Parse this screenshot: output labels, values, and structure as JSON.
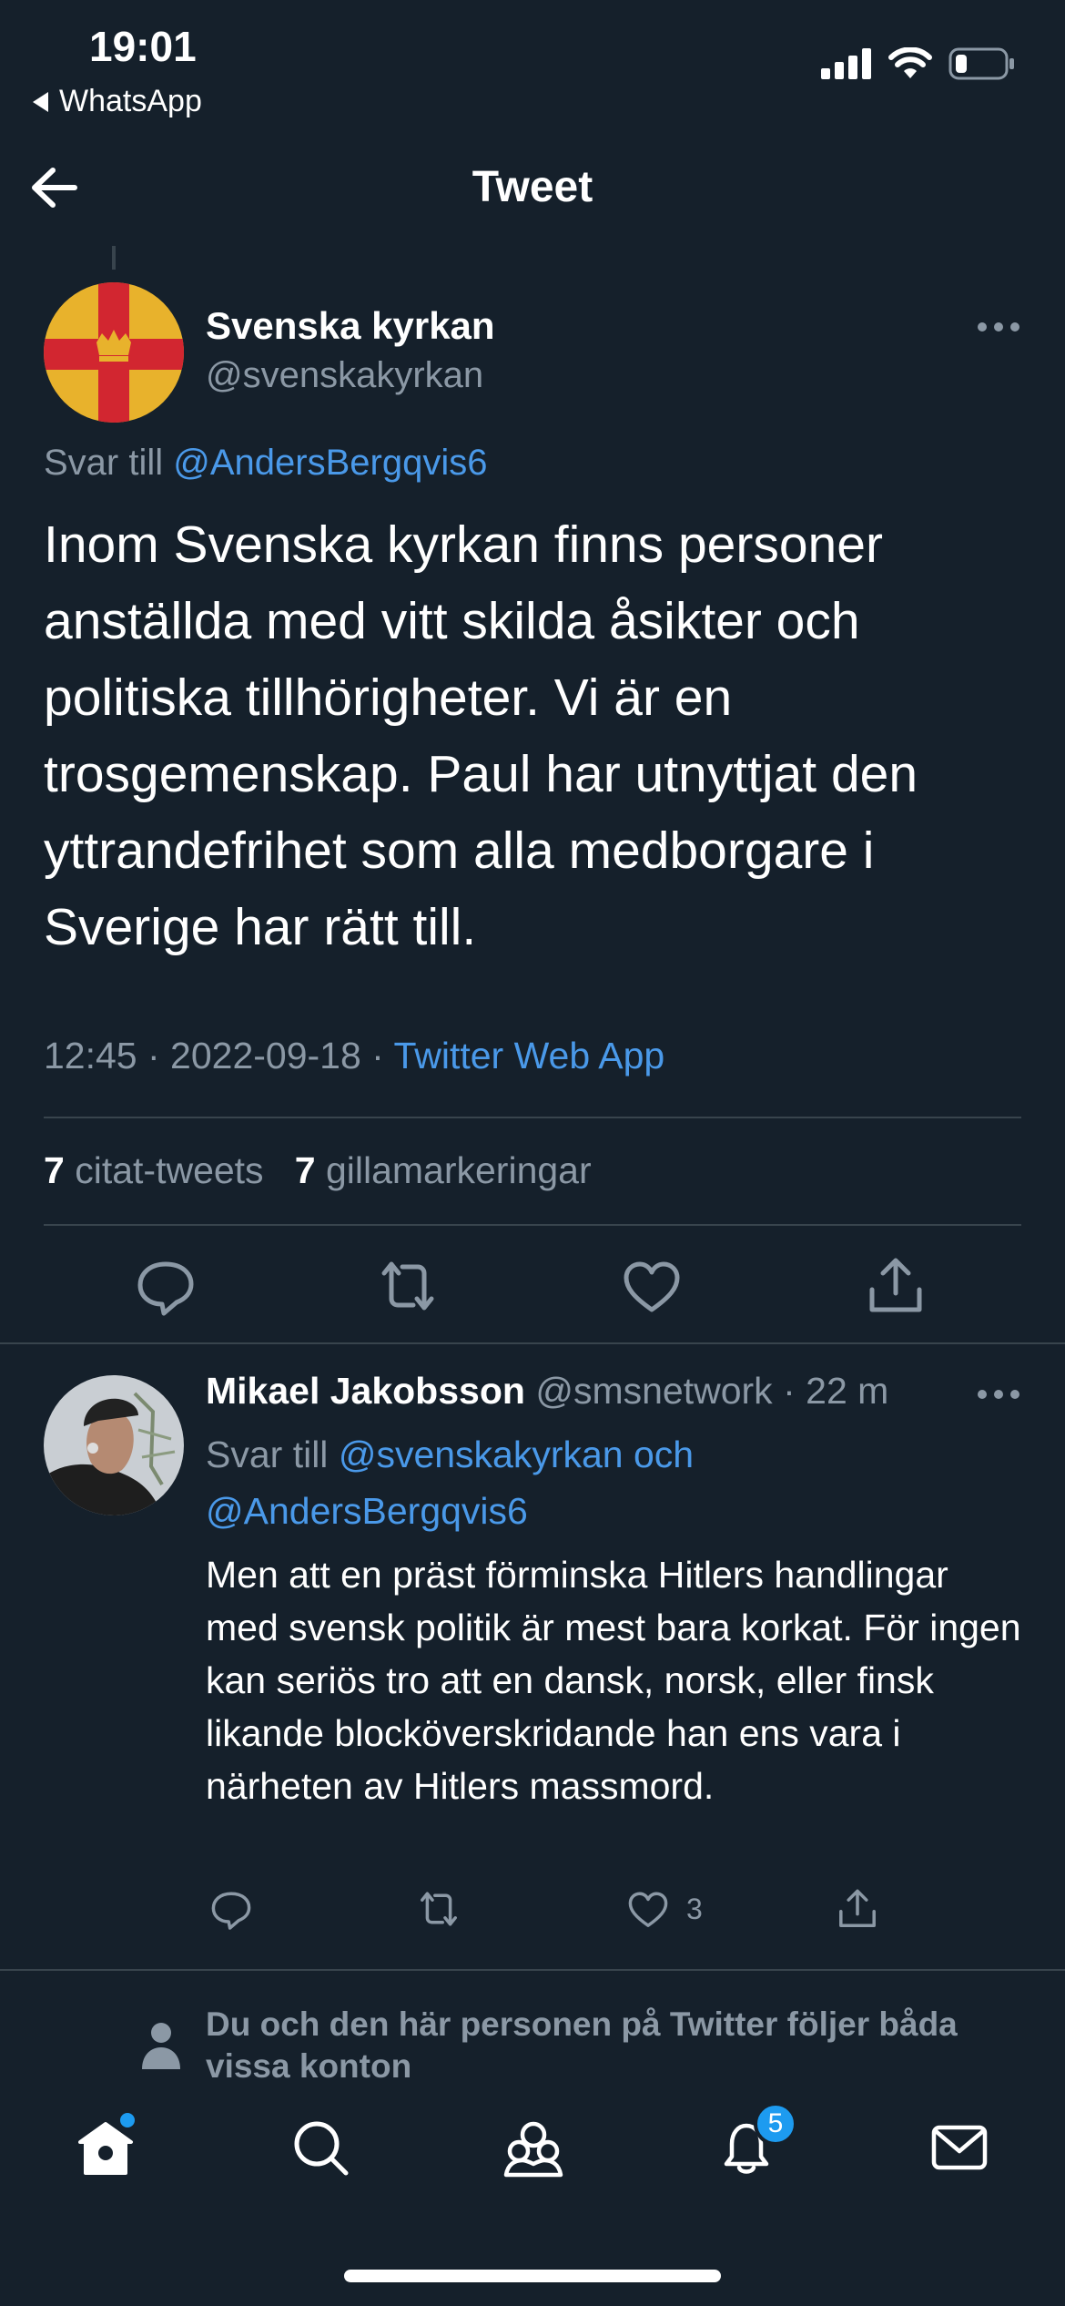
{
  "status_bar": {
    "time": "19:01",
    "back_app": "WhatsApp",
    "icons": [
      "signal-icon",
      "wifi-icon",
      "battery-icon"
    ]
  },
  "header": {
    "title": "Tweet",
    "back_icon": "arrow-left-icon"
  },
  "main_tweet": {
    "name": "Svenska kyrkan",
    "handle": "@svenskakyrkan",
    "replying_prefix": "Svar till",
    "replying_to": "@AndersBergqvis6",
    "text": "Inom Svenska kyrkan finns personer anställda med vitt skilda åsikter och politiska tillhörigheter. Vi är en trosgemenskap. Paul har utnyttjat den yttrandefrihet som alla medborgare i Sverige har rätt till.",
    "timestamp": "12:45 · 2022-09-18 · ",
    "source": "Twitter Web App",
    "quote_count": "7",
    "quote_label": "citat-tweets",
    "like_count": "7",
    "like_label": "gillamarkeringar"
  },
  "reply": {
    "name": "Mikael Jakobsson",
    "handle": "@smsnetwork",
    "time": "· 22 m",
    "replying_prefix": "Svar till",
    "replying_to_1": "@svenskakyrkan och",
    "replying_to_2": "@AndersBergqvis6",
    "text": "Men att en präst förminska Hitlers handlingar med svensk politik är mest bara korkat. För ingen kan seriös tro att en dansk, norsk, eller finsk likande blocköverskridande han ens vara i närheten av Hitlers massmord.",
    "like_count": "3"
  },
  "follow_note": {
    "text": "Du och den här personen på Twitter följer båda vissa konton"
  },
  "tab_bar": {
    "notifications_badge": "5",
    "tabs": [
      "home-icon",
      "search-icon",
      "communities-icon",
      "notifications-icon",
      "messages-icon"
    ]
  },
  "colors": {
    "background": "#15202b",
    "accent": "#1d9bf0",
    "muted": "#8b98a5",
    "divider": "#38444d"
  }
}
